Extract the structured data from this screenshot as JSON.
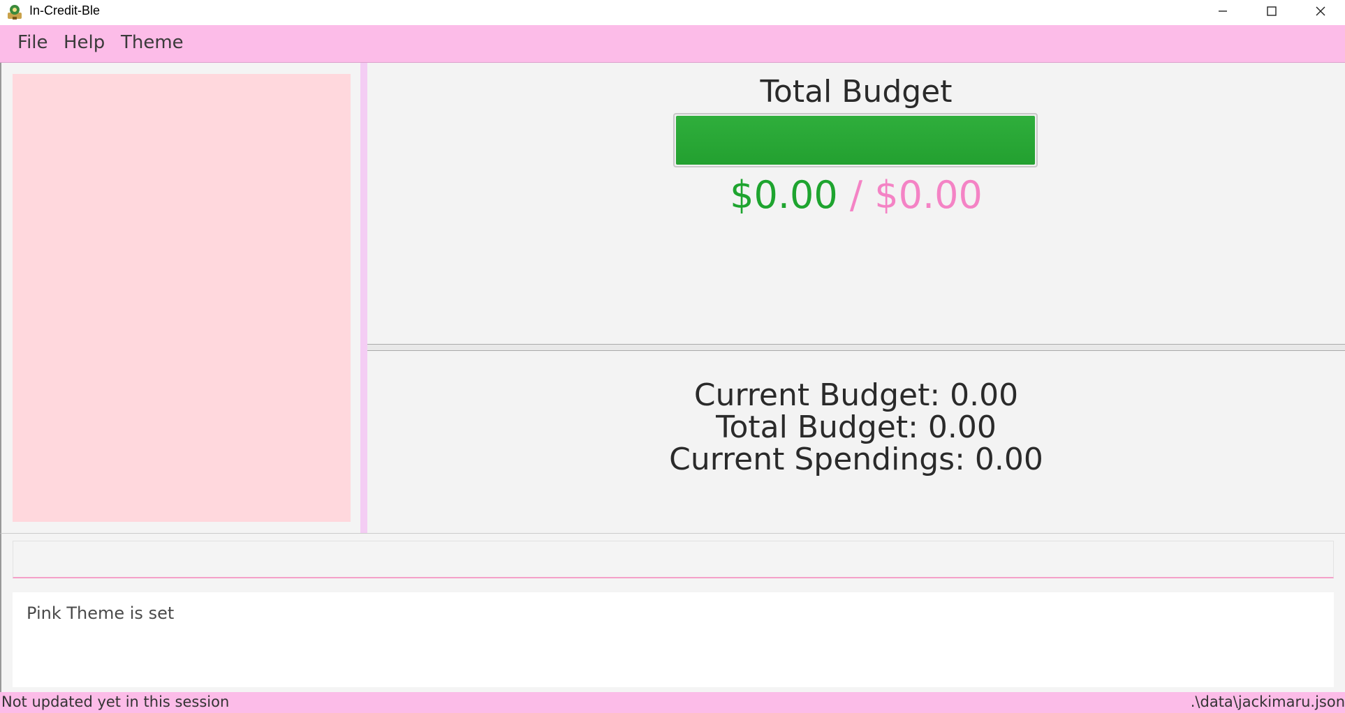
{
  "window": {
    "title": "In-Credit-Ble",
    "app_icon": "app-logo-icon",
    "controls": [
      "minimize-icon",
      "maximize-icon",
      "close-icon"
    ]
  },
  "menu": {
    "items": [
      {
        "label": "File"
      },
      {
        "label": "Help"
      },
      {
        "label": "Theme"
      }
    ]
  },
  "budget": {
    "title": "Total Budget",
    "progress_fraction": 1.0,
    "spent": "$0.00",
    "separator": "/",
    "total": "$0.00"
  },
  "stats": {
    "current_budget": "Current Budget: 0.00",
    "total_budget": "Total Budget: 0.00",
    "current_spendings": "Current Spendings: 0.00"
  },
  "command": {
    "value": "",
    "placeholder": ""
  },
  "result": {
    "message": "Pink Theme is set"
  },
  "status": {
    "sync": "Not updated yet in this session",
    "file_path": ".\\data\\jackimaru.json"
  },
  "colors": {
    "menu_bar": "#fcbce8",
    "list_background": "#ffd8dd",
    "progress_fill": "#2fae3c",
    "spent_text": "#1ea42f",
    "total_text": "#f483c5"
  }
}
